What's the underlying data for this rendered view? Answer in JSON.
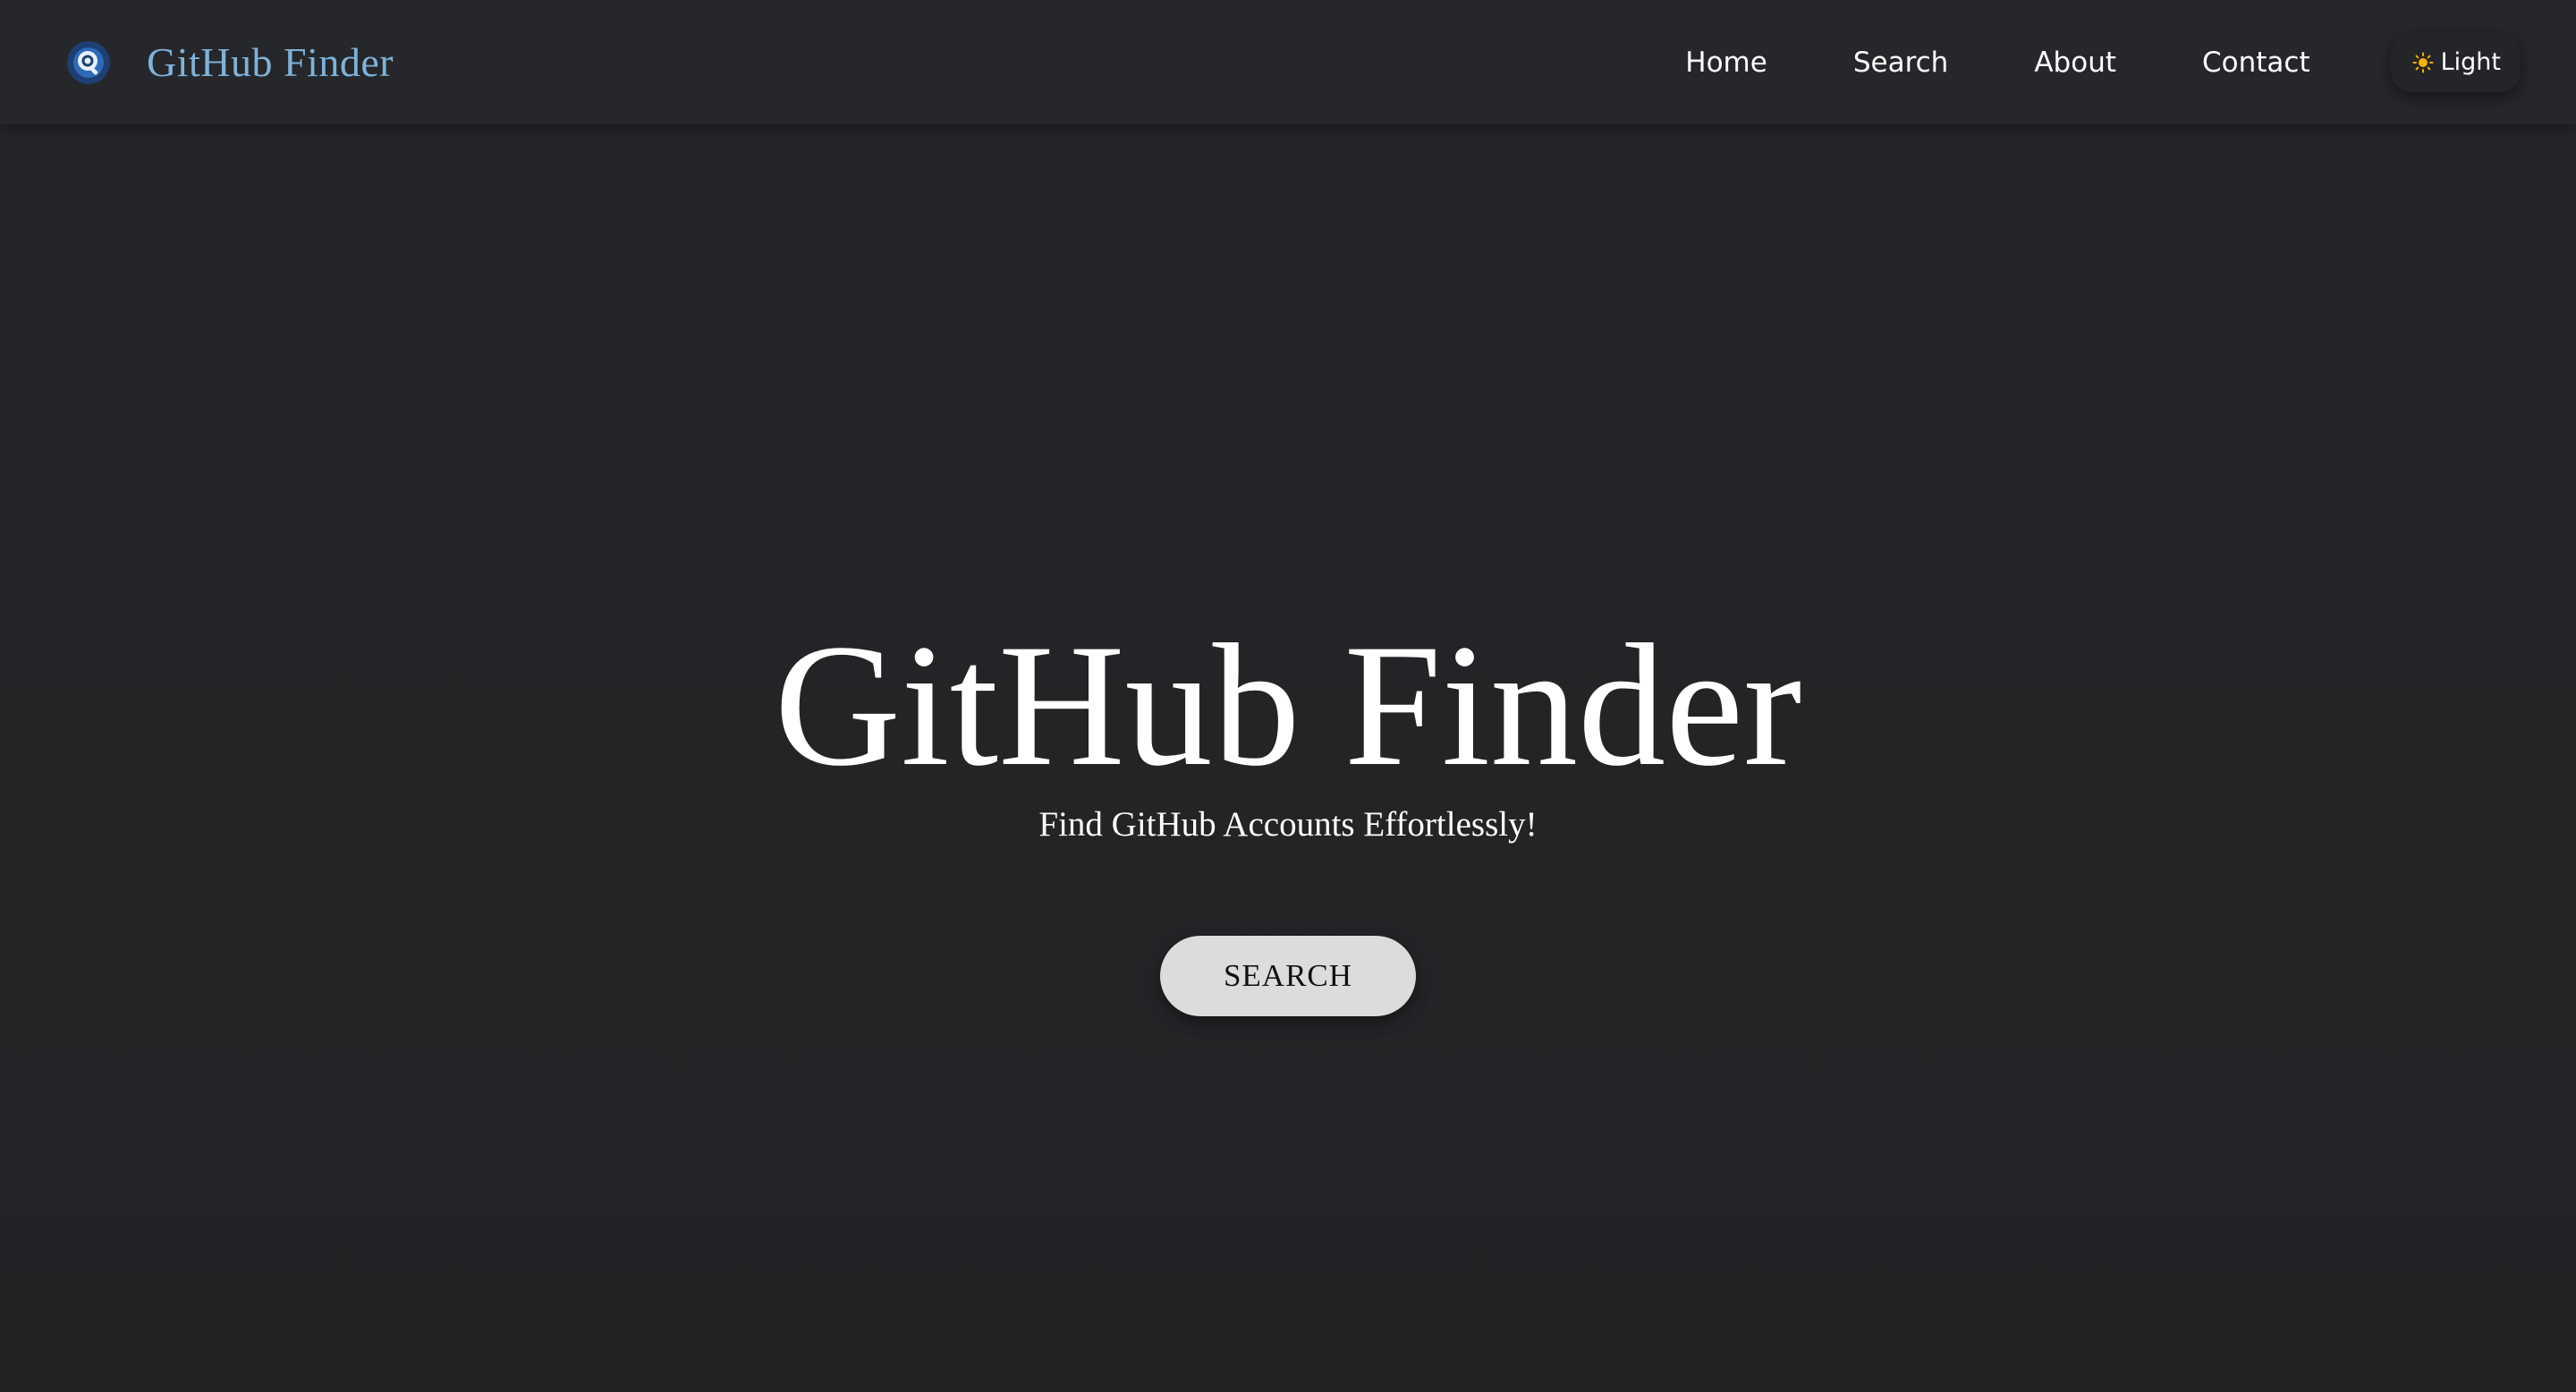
{
  "navbar": {
    "brand": {
      "logo_icon": "magnifier-logo-icon",
      "name": "GitHub Finder"
    },
    "links": [
      {
        "label": "Home"
      },
      {
        "label": "Search"
      },
      {
        "label": "About"
      },
      {
        "label": "Contact"
      }
    ],
    "theme_toggle": {
      "icon": "sun-icon",
      "label": "Light"
    }
  },
  "hero": {
    "title": "GitHub Finder",
    "subtitle": "Find GitHub Accounts Effortlessly!",
    "button_label": "SEARCH"
  },
  "colors": {
    "background": "#222426",
    "navbar": "#25272a",
    "brand_text": "#7fb2d9",
    "button_bg": "#dcdcdc",
    "sun": "#f5b400"
  }
}
